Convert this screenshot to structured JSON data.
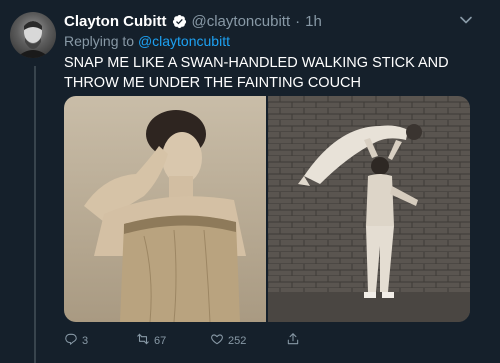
{
  "tweet": {
    "display_name": "Clayton Cubitt",
    "handle": "@claytoncubitt",
    "separator": "·",
    "time": "1h",
    "replying_prefix": "Replying to",
    "replying_to": "@claytoncubitt",
    "text": "SNAP ME LIKE A SWAN-HANDLED WALKING STICK AND THROW ME UNDER THE FAINTING COUCH"
  },
  "actions": {
    "reply_count": "3",
    "retweet_count": "67",
    "like_count": "252"
  },
  "icons": {
    "verified": "verified-badge-icon",
    "more": "chevron-down-icon",
    "reply": "reply-icon",
    "retweet": "retweet-icon",
    "like": "heart-icon",
    "share": "share-icon"
  },
  "colors": {
    "background": "#15202b",
    "text_primary": "#ffffff",
    "text_secondary": "#8899a6",
    "accent": "#1da1f2"
  }
}
